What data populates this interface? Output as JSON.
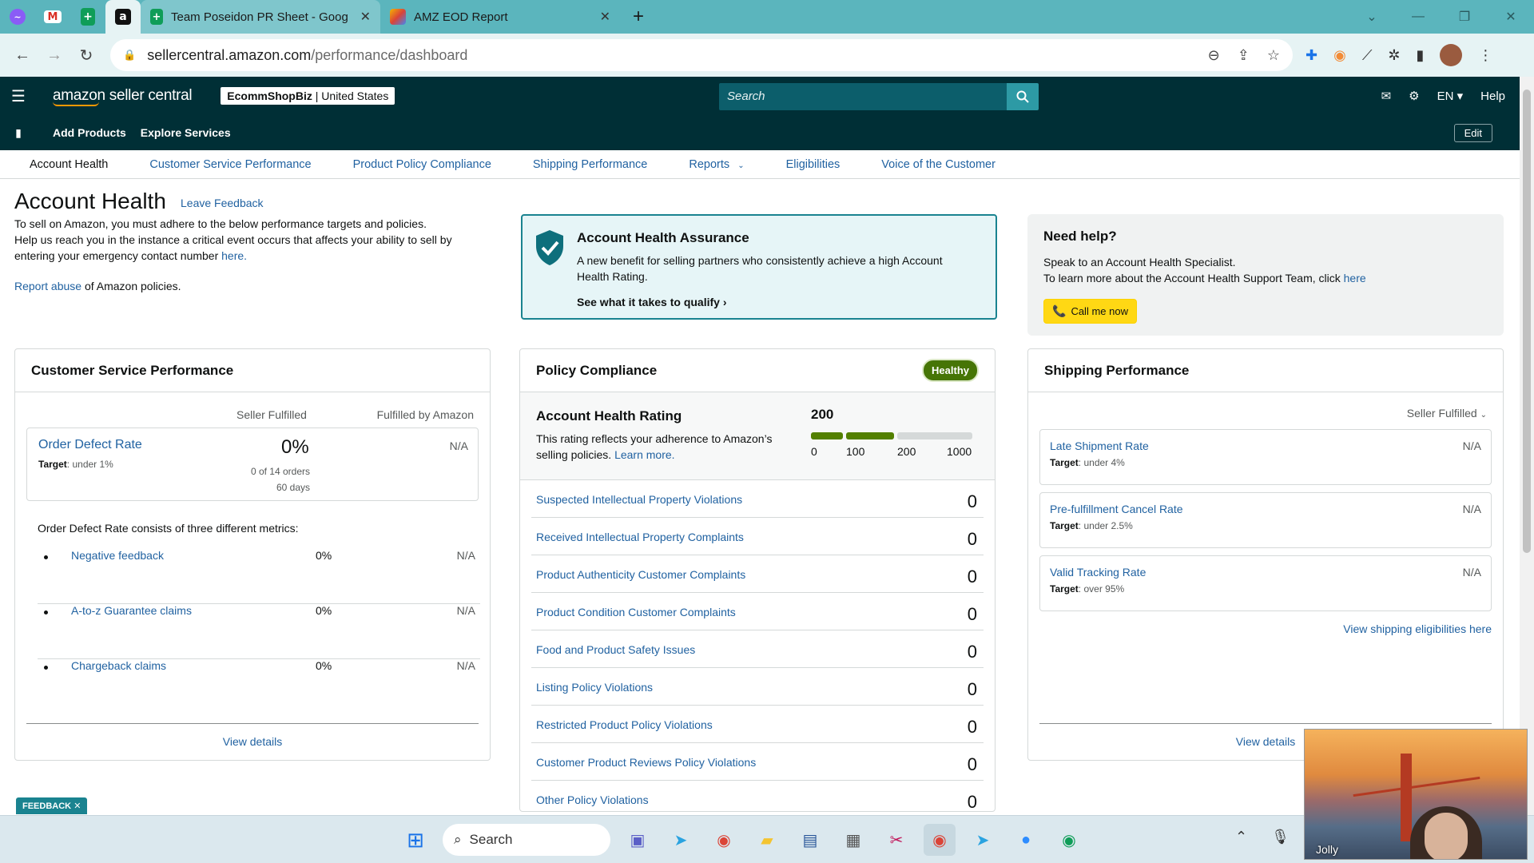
{
  "browser": {
    "tabs": [
      {
        "title": "Team Poseidon PR Sheet - Goog"
      },
      {
        "title": "AMZ EOD Report"
      }
    ],
    "url_host": "sellercentral.amazon.com",
    "url_path": "/performance/dashboard"
  },
  "header": {
    "brand": "amazon seller central",
    "store_name": "EcommShopBiz",
    "store_region": "United States",
    "search_placeholder": "Search",
    "language": "EN",
    "help": "Help"
  },
  "subnav": {
    "items": [
      "Add Products",
      "Explore Services"
    ],
    "edit": "Edit"
  },
  "tabs": [
    "Account Health",
    "Customer Service Performance",
    "Product Policy Compliance",
    "Shipping Performance",
    "Reports",
    "Eligibilities",
    "Voice of the Customer"
  ],
  "page": {
    "title": "Account Health",
    "leave_feedback": "Leave Feedback",
    "intro_1": "To sell on Amazon, you must adhere to the below performance targets and policies.",
    "intro_2": "Help us reach you in the instance a critical event occurs that affects your ability to sell by entering your emergency contact number",
    "intro_here": "here.",
    "report_link": "Report abuse",
    "report_rest": "of Amazon policies."
  },
  "assurance": {
    "title": "Account Health Assurance",
    "text": "A new benefit for selling partners who consistently achieve a high Account Health Rating.",
    "cta": "See what it takes to qualify"
  },
  "help": {
    "title": "Need help?",
    "line1": "Speak to an Account Health Specialist.",
    "line2": "To learn more about the Account Health Support Team, click",
    "here": "here",
    "call": "Call me now"
  },
  "csp": {
    "title": "Customer Service Performance",
    "col_seller": "Seller Fulfilled",
    "col_fba": "Fulfilled by Amazon",
    "odr_title": "Order Defect Rate",
    "odr_target_label": "Target",
    "odr_target": ": under 1%",
    "odr_pct": "0%",
    "odr_orders": "0 of 14 orders",
    "odr_days": "60 days",
    "odr_fba": "N/A",
    "consists": "Order Defect Rate consists of three different metrics:",
    "metrics": [
      {
        "label": "Negative feedback",
        "pct": "0%",
        "na": "N/A"
      },
      {
        "label": "A-to-z Guarantee claims",
        "pct": "0%",
        "na": "N/A"
      },
      {
        "label": "Chargeback claims",
        "pct": "0%",
        "na": "N/A"
      }
    ],
    "view_details": "View details"
  },
  "policy": {
    "title": "Policy Compliance",
    "status": "Healthy",
    "ahr_title": "Account Health Rating",
    "ahr_text": "This rating reflects your adherence to Amazon’s selling policies.",
    "learn_more": "Learn more.",
    "score": "200",
    "score_value": 200,
    "ticks": [
      "0",
      "100",
      "200",
      "1000"
    ],
    "violations": [
      {
        "label": "Suspected Intellectual Property Violations",
        "count": "0"
      },
      {
        "label": "Received Intellectual Property Complaints",
        "count": "0"
      },
      {
        "label": "Product Authenticity Customer Complaints",
        "count": "0"
      },
      {
        "label": "Product Condition Customer Complaints",
        "count": "0"
      },
      {
        "label": "Food and Product Safety Issues",
        "count": "0"
      },
      {
        "label": "Listing Policy Violations",
        "count": "0"
      },
      {
        "label": "Restricted Product Policy Violations",
        "count": "0"
      },
      {
        "label": "Customer Product Reviews Policy Violations",
        "count": "0"
      },
      {
        "label": "Other Policy Violations",
        "count": "0"
      }
    ]
  },
  "shipping": {
    "title": "Shipping Performance",
    "filter": "Seller Fulfilled",
    "metrics": [
      {
        "label": "Late Shipment Rate",
        "target_label": "Target",
        "target": ": under 4%",
        "value": "N/A"
      },
      {
        "label": "Pre-fulfillment Cancel Rate",
        "target_label": "Target",
        "target": ": under 2.5%",
        "value": "N/A"
      },
      {
        "label": "Valid Tracking Rate",
        "target_label": "Target",
        "target": ": over 95%",
        "value": "N/A"
      }
    ],
    "eligibilities": "View shipping eligibilities here",
    "view_details": "View details"
  },
  "feedback_tab": "FEEDBACK",
  "taskbar": {
    "search": "Search"
  },
  "video": {
    "name": "Jolly"
  },
  "colors": {
    "header_bg": "#002f36",
    "link": "#2162a1",
    "healthy": "#467506",
    "callbtn": "#ffd814",
    "tabstrip": "#5bb5bd"
  }
}
